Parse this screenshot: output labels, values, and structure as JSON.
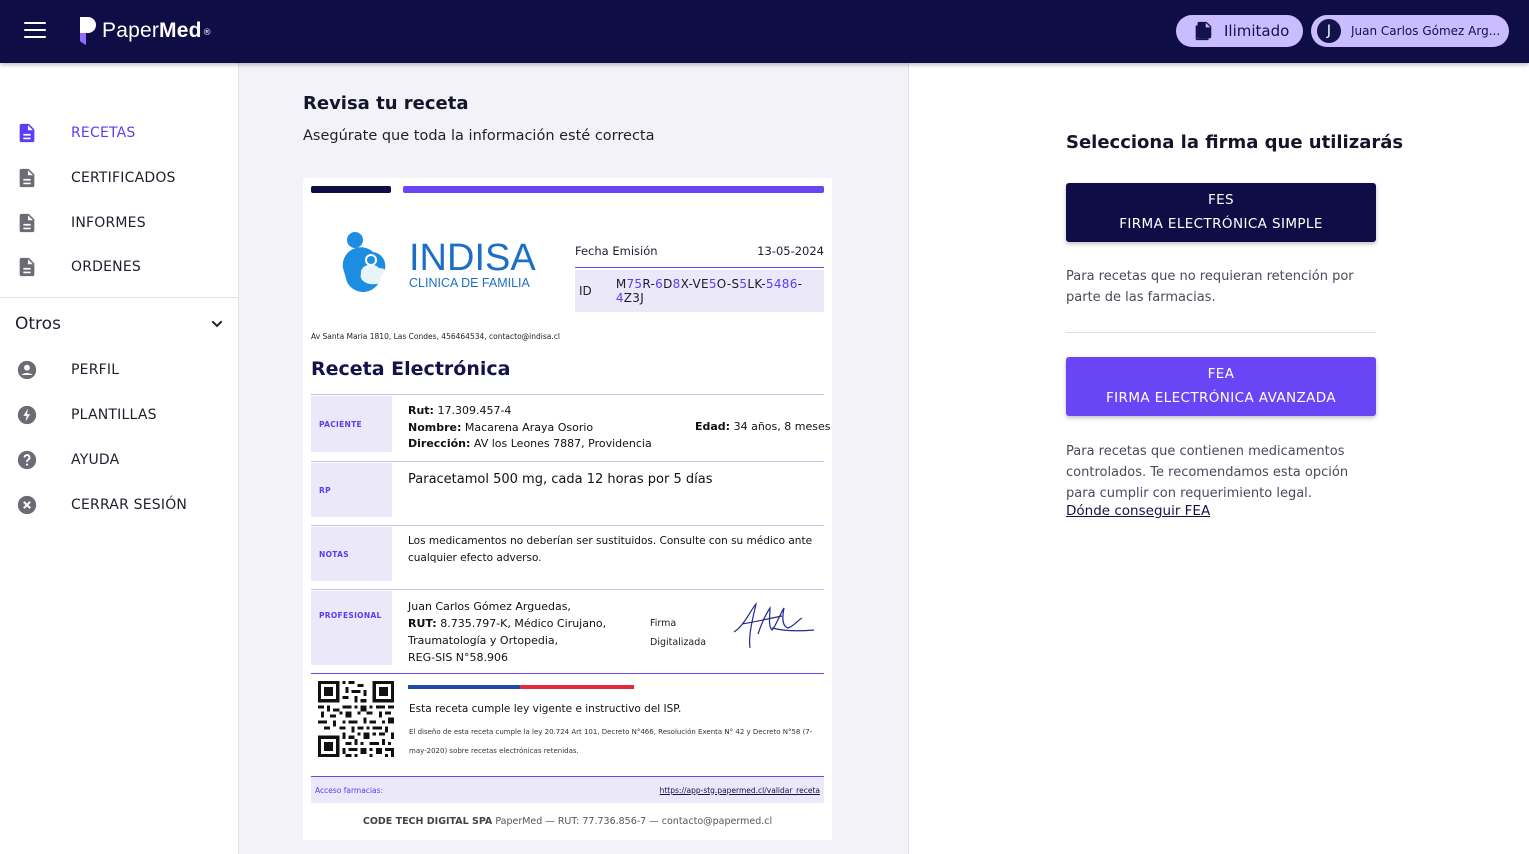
{
  "header": {
    "brand_light": "Paper",
    "brand_bold": "Med",
    "brand_reg": "®",
    "plan_label": "Ilimitado",
    "user_initial": "J",
    "user_name": "Juan Carlos Gómez Arg..."
  },
  "sidebar": {
    "items": [
      {
        "label": "RECETAS",
        "icon": "document-icon",
        "active": true
      },
      {
        "label": "CERTIFICADOS",
        "icon": "document-icon"
      },
      {
        "label": "INFORMES",
        "icon": "document-icon"
      },
      {
        "label": "ORDENES",
        "icon": "document-icon"
      }
    ],
    "section_title": "Otros",
    "other_items": [
      {
        "label": "PERFIL",
        "icon": "account-circle-icon"
      },
      {
        "label": "PLANTILLAS",
        "icon": "bolt-icon"
      },
      {
        "label": "AYUDA",
        "icon": "help-circle-icon"
      },
      {
        "label": "CERRAR SESIÓN",
        "icon": "cancel-circle-icon"
      }
    ]
  },
  "review": {
    "title": "Revisa tu receta",
    "subtitle": "Asegúrate que toda la información esté correcta"
  },
  "prescription": {
    "clinic_name": "INDISA",
    "clinic_tagline": "CLINICA DE FAMILIA",
    "issue_label": "Fecha Emisión",
    "issue_date": "13-05-2024",
    "id_label": "ID",
    "id_parts": [
      "M",
      "75",
      "R-",
      "6",
      "D",
      "8",
      "X-VE",
      "5",
      "O-S",
      "5",
      "LK-",
      "5486",
      "-",
      "4",
      "Z3J"
    ],
    "address": "Av Santa Maria 1810, Las Condes, 456464534, contacto@indisa.cl",
    "title": "Receta Electrónica",
    "patient_label": "PACIENTE",
    "rut_label": "Rut:",
    "rut_value": "17.309.457-4",
    "name_label": "Nombre:",
    "name_value": "Macarena Araya Osorio",
    "address_label": "Dirección:",
    "address_value": "AV los Leones 7887, Providencia",
    "age_label": "Edad:",
    "age_value": "34 años, 8 meses",
    "rp_label": "RP",
    "rp_text": "Paracetamol 500 mg, cada 12 horas por 5 días",
    "notes_label": "NOTAS",
    "notes_text": "Los medicamentos no deberían ser sustituidos. Consulte con su médico ante cualquier efecto adverso.",
    "professional_label": "PROFESIONAL",
    "prof_name": "Juan Carlos Gómez Arguedas,",
    "prof_rut_label": "RUT:",
    "prof_rut_value": "8.735.797-K, Médico Cirujano,",
    "prof_specialty": "Traumatología y Ortopedia,",
    "prof_reg": "REG-SIS N°58.906",
    "signature_label_1": "Firma",
    "signature_label_2": "Digitalizada",
    "isp_text": "Esta receta cumple ley vigente e instructivo del ISP.",
    "legal_text": "El diseño de esta receta cumple la ley 20.724 Art 101, Decreto N°466, Resolución Exenta N° 42 y Decreto N°58 (7-may-2020) sobre recetas electrónicas retenidas.",
    "access_label": "Acceso farmacias:",
    "access_url": "https://app-stg.papermed.cl/validar_receta",
    "footer_company": "CODE TECH DIGITAL SPA",
    "footer_rest": " PaperMed — RUT: 77.736.856-7 — contacto@papermed.cl"
  },
  "signature_panel": {
    "title": "Selecciona la firma que utilizarás",
    "fes_code": "FES",
    "fes_name": "FIRMA ELECTRÓNICA SIMPLE",
    "fes_desc": "Para recetas que no requieran retención por parte de las farmacias.",
    "fea_code": "FEA",
    "fea_name": "FIRMA ELECTRÓNICA AVANZADA",
    "fea_desc": "Para recetas que contienen medicamentos controlados. Te recomendamos esta opción para cumplir con requerimiento legal.",
    "fea_link": "Dónde conseguir FEA"
  },
  "colors": {
    "navy": "#0f0d45",
    "accent": "#6a45f5",
    "pill": "#c9bcff",
    "panel_bg": "#f2f2f8"
  }
}
